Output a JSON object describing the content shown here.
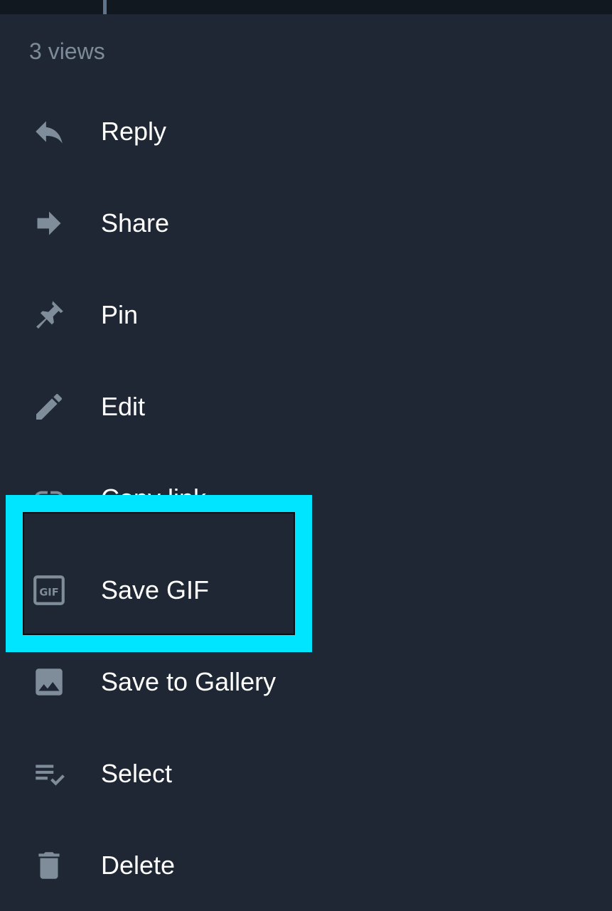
{
  "header": {
    "views_text": "3 views"
  },
  "menu": {
    "items": [
      {
        "label": "Reply",
        "icon": "reply-icon"
      },
      {
        "label": "Share",
        "icon": "share-arrow-icon"
      },
      {
        "label": "Pin",
        "icon": "pin-icon"
      },
      {
        "label": "Edit",
        "icon": "pencil-icon"
      },
      {
        "label": "Copy link",
        "icon": "link-icon"
      },
      {
        "label": "Save GIF",
        "icon": "gif-icon"
      },
      {
        "label": "Save to Gallery",
        "icon": "image-icon"
      },
      {
        "label": "Select",
        "icon": "select-checklist-icon"
      },
      {
        "label": "Delete",
        "icon": "trash-icon"
      }
    ]
  },
  "highlight": {
    "target": "Save GIF",
    "color": "#00e5ff"
  },
  "colors": {
    "background": "#1e2733",
    "icon": "#7f8c99",
    "text": "#ffffff",
    "muted_text": "#7d8b99"
  }
}
